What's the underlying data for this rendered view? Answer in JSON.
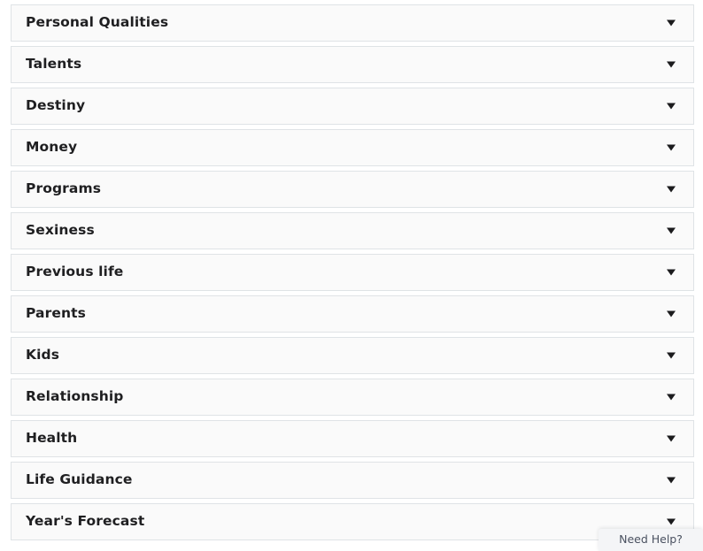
{
  "accordion": {
    "chevron_icon": "chevron-down-icon",
    "items": [
      {
        "label": "Personal Qualities"
      },
      {
        "label": "Talents"
      },
      {
        "label": "Destiny"
      },
      {
        "label": "Money"
      },
      {
        "label": "Programs"
      },
      {
        "label": "Sexiness"
      },
      {
        "label": "Previous life"
      },
      {
        "label": "Parents"
      },
      {
        "label": "Kids"
      },
      {
        "label": "Relationship"
      },
      {
        "label": "Health"
      },
      {
        "label": "Life Guidance"
      },
      {
        "label": "Year's Forecast"
      }
    ]
  },
  "support_widget": {
    "label": "Need Help?",
    "background_color": "#f4f5f7",
    "text_color": "#4a5160"
  },
  "colors": {
    "row_background": "#fafafa",
    "row_border": "#dfe3e6",
    "label_text": "#1f1f21",
    "page_background": "#ffffff"
  }
}
